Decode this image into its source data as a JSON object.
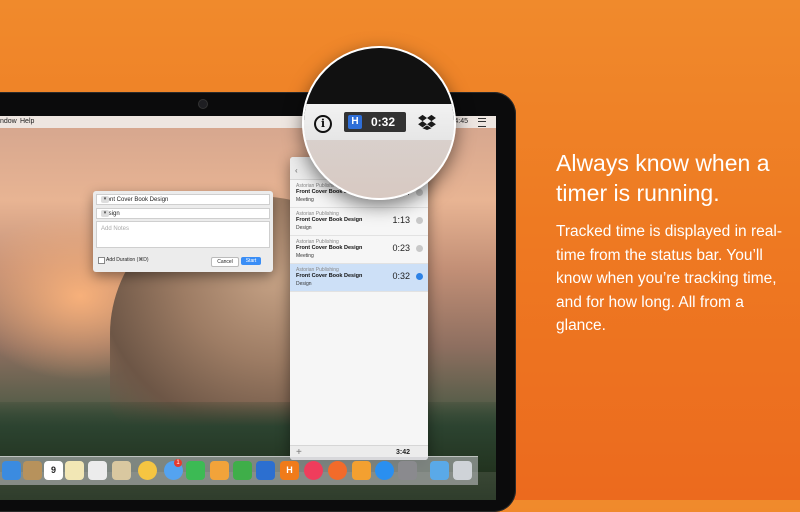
{
  "menubar": {
    "items": [
      "ndow",
      "Help"
    ],
    "clock": "14:45"
  },
  "new_timer_form": {
    "project_value": "Front Cover Book Design",
    "task_value": "Design",
    "notes_placeholder": "Add Notes",
    "add_duration_label": "Add Duration (⌘D)",
    "cancel_label": "Cancel",
    "start_label": "Start"
  },
  "timer_list": {
    "rows": [
      {
        "client": "Astorian Publishing",
        "project": "Front Cover Book Design",
        "task": "Meeting",
        "time": "1:34",
        "active": false
      },
      {
        "client": "Astorian Publishing",
        "project": "Front Cover Book Design",
        "task": "Design",
        "time": "1:13",
        "active": false
      },
      {
        "client": "Astorian Publishing",
        "project": "Front Cover Book Design",
        "task": "Meeting",
        "time": "0:23",
        "active": false
      },
      {
        "client": "Astorian Publishing",
        "project": "Front Cover Book Design",
        "task": "Design",
        "time": "0:32",
        "active": true
      }
    ],
    "total": "3:42"
  },
  "magnifier": {
    "app_letter": "H",
    "running_time": "0:32",
    "icons": [
      "info-icon",
      "harvest-timer-icon",
      "dropbox-icon"
    ]
  },
  "dock": {
    "calendar_day": "9",
    "harvest_letter": "H",
    "messages_badge": "1",
    "icons": [
      "finder-icon",
      "notes-icon",
      "calendar-icon",
      "reminders-icon",
      "preview-icon",
      "photos-icon",
      "messages-icon",
      "facetime-icon",
      "pages-icon",
      "numbers-icon",
      "keynote-icon",
      "harvest-icon",
      "music-icon",
      "books-icon",
      "ibooks-icon",
      "app-store-icon",
      "system-preferences-icon",
      "downloads-folder-icon",
      "trash-icon"
    ]
  },
  "marketing": {
    "headline": "Always know when a timer is running.",
    "body": "Tracked time is displayed in real-time from the status bar. You’ll know when you’re tracking time, and for how long. All from a glance."
  },
  "colors": {
    "background": "#ee7a22",
    "accent_blue": "#2f6fd8",
    "start_button": "#3a8ef6"
  }
}
